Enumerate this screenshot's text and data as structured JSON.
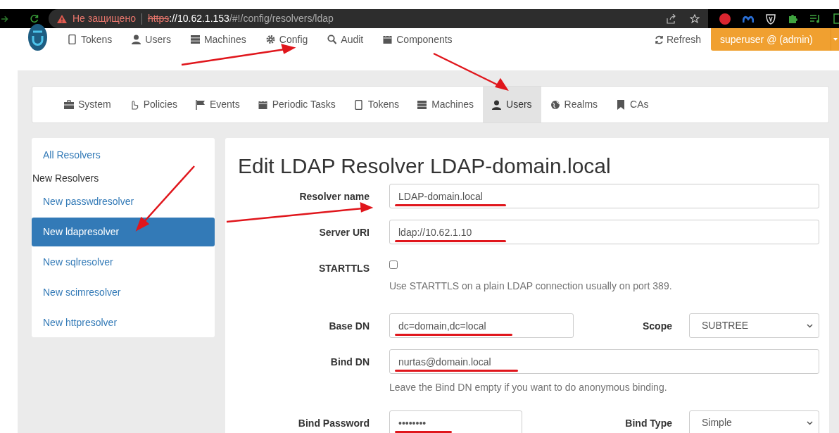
{
  "browser": {
    "security_label": "Не защищено",
    "url": {
      "scheme": "https",
      "host": "://10.62.1.153",
      "path": "/#!/config/resolvers/ldap"
    }
  },
  "nav": {
    "items": [
      {
        "label": "Tokens"
      },
      {
        "label": "Users"
      },
      {
        "label": "Machines"
      },
      {
        "label": "Config"
      },
      {
        "label": "Audit"
      },
      {
        "label": "Components"
      }
    ],
    "refresh": "Refresh",
    "user": "superuser @ (admin)"
  },
  "config_tabs": [
    {
      "label": "System",
      "selected": false
    },
    {
      "label": "Policies",
      "selected": false
    },
    {
      "label": "Events",
      "selected": false
    },
    {
      "label": "Periodic Tasks",
      "selected": false
    },
    {
      "label": "Tokens",
      "selected": false
    },
    {
      "label": "Machines",
      "selected": false
    },
    {
      "label": "Users",
      "selected": true
    },
    {
      "label": "Realms",
      "selected": false
    },
    {
      "label": "CAs",
      "selected": false
    }
  ],
  "sidebar": {
    "all_link": "All Resolvers",
    "heading": "New Resolvers",
    "items": [
      {
        "label": "New passwdresolver",
        "selected": false
      },
      {
        "label": "New ldapresolver",
        "selected": true
      },
      {
        "label": "New sqlresolver",
        "selected": false
      },
      {
        "label": "New scimresolver",
        "selected": false
      },
      {
        "label": "New httpresolver",
        "selected": false
      }
    ]
  },
  "form": {
    "title": "Edit LDAP Resolver LDAP-domain.local",
    "fields": [
      {
        "kind": "text",
        "label": "Resolver name",
        "value": "LDAP-domain.local",
        "underlined": true
      },
      {
        "kind": "text",
        "label": "Server URI",
        "value": "ldap://10.62.1.10",
        "underlined": true
      },
      {
        "kind": "checkbox",
        "label": "STARTTLS",
        "checked": false,
        "help": "Use STARTTLS on a plain LDAP connection usually on port 389."
      },
      {
        "kind": "pair",
        "label": "Base DN",
        "value": "dc=domain,dc=local",
        "underlined": true,
        "select_label": "Scope",
        "select_value": "SUBTREE"
      },
      {
        "kind": "text",
        "label": "Bind DN",
        "value": "nurtas@domain.local",
        "underlined": true,
        "help": "Leave the Bind DN empty if you want to do anonymous binding."
      },
      {
        "kind": "pair",
        "label": "Bind Password",
        "value": "••••••••",
        "underlined": true,
        "select_label": "Bind Type",
        "select_value": "Simple"
      }
    ]
  }
}
